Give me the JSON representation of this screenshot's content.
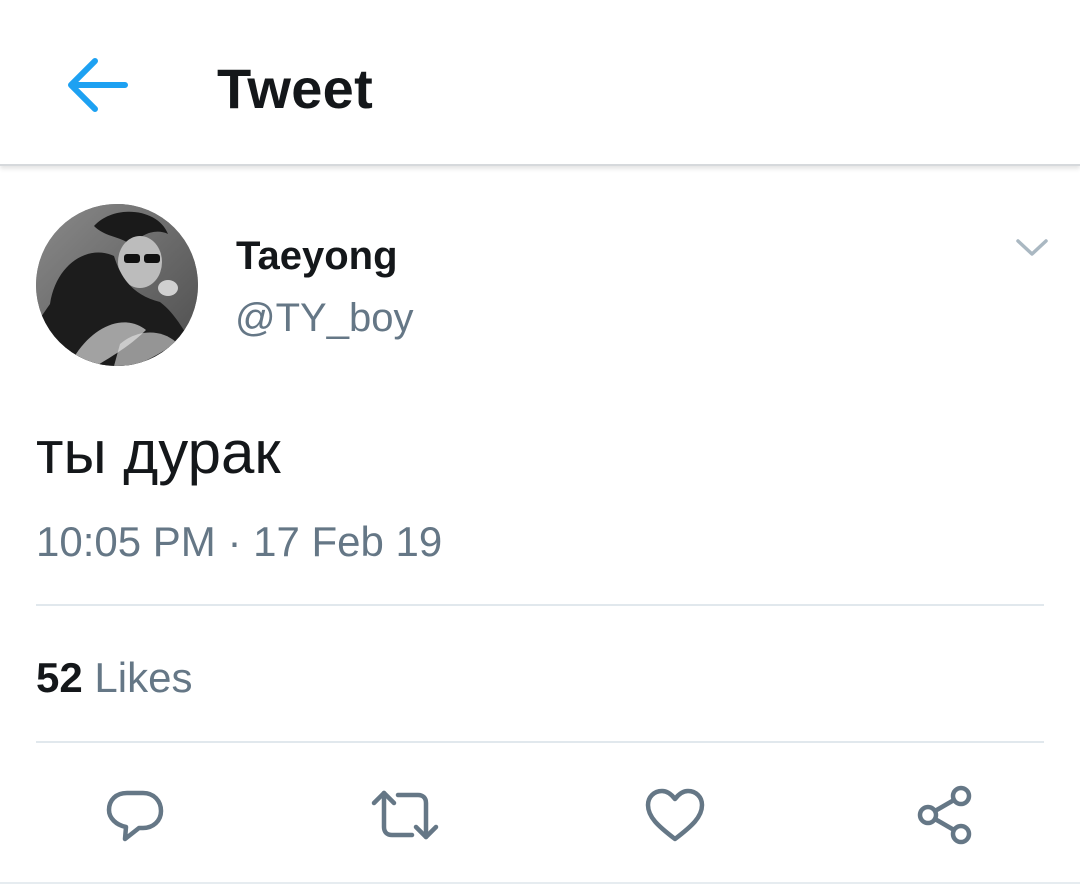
{
  "header": {
    "title": "Tweet",
    "back_icon": "arrow-left-icon",
    "accent_color": "#1da1f2"
  },
  "tweet": {
    "author": {
      "display_name": "Taeyong",
      "handle": "@TY_boy"
    },
    "text": "ты дурак",
    "timestamp": "10:05 PM · 17 Feb 19",
    "menu_icon": "chevron-down-icon"
  },
  "stats": {
    "likes_count": "52",
    "likes_label": "Likes"
  },
  "actions": [
    {
      "name": "reply",
      "icon": "reply-icon"
    },
    {
      "name": "retweet",
      "icon": "retweet-icon"
    },
    {
      "name": "like",
      "icon": "heart-icon"
    },
    {
      "name": "share",
      "icon": "share-icon"
    }
  ],
  "colors": {
    "text_primary": "#14171a",
    "text_secondary": "#657786",
    "icon_gray": "#657786",
    "divider": "#e1e8ed"
  }
}
